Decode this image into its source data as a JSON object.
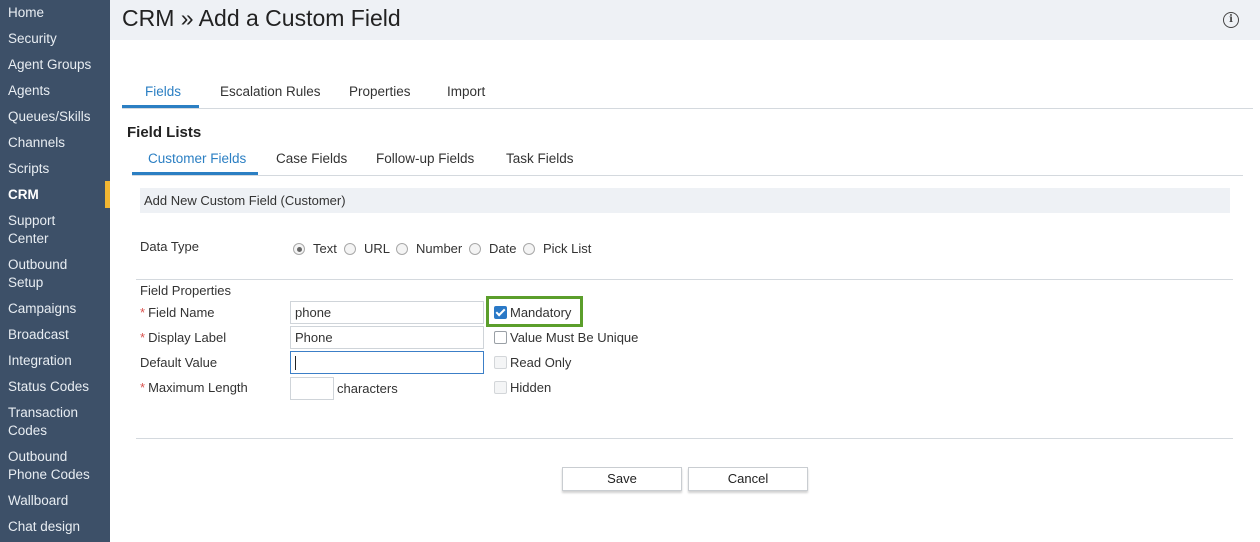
{
  "sidebar": {
    "items": [
      {
        "label": "Home"
      },
      {
        "label": "Security"
      },
      {
        "label": "Agent Groups"
      },
      {
        "label": "Agents"
      },
      {
        "label": "Queues/Skills"
      },
      {
        "label": "Channels"
      },
      {
        "label": "Scripts"
      },
      {
        "label": "CRM"
      },
      {
        "label": "Support Center"
      },
      {
        "label": "Outbound Setup"
      },
      {
        "label": "Campaigns"
      },
      {
        "label": "Broadcast"
      },
      {
        "label": "Integration"
      },
      {
        "label": "Status Codes"
      },
      {
        "label": "Transaction Codes"
      },
      {
        "label": "Outbound Phone Codes"
      },
      {
        "label": "Wallboard"
      },
      {
        "label": "Chat design"
      }
    ],
    "active": "CRM",
    "active_marker_color": "#f2b632"
  },
  "header": {
    "title": "CRM » Add a Custom Field",
    "info_icon": "info-icon"
  },
  "main_tabs": [
    {
      "label": "Fields",
      "active": true
    },
    {
      "label": "Escalation Rules"
    },
    {
      "label": "Properties"
    },
    {
      "label": "Import"
    }
  ],
  "field_lists": {
    "heading": "Field Lists",
    "tabs": [
      {
        "label": "Customer Fields",
        "active": true
      },
      {
        "label": "Case Fields"
      },
      {
        "label": "Follow-up Fields"
      },
      {
        "label": "Task Fields"
      }
    ]
  },
  "form": {
    "panel_title": "Add New Custom Field (Customer)",
    "data_type": {
      "label": "Data Type",
      "options": [
        "Text",
        "URL",
        "Number",
        "Date",
        "Pick List"
      ],
      "selected": "Text"
    },
    "field_properties_label": "Field Properties",
    "field_name": {
      "label": "Field Name",
      "value": "phone",
      "required": "*"
    },
    "display_label": {
      "label": "Display Label",
      "value": "Phone",
      "required": "*"
    },
    "default_value": {
      "label": "Default Value",
      "value": ""
    },
    "maximum_length": {
      "label": "Maximum Length",
      "value": "",
      "unit": "characters",
      "required": "*"
    },
    "checkboxes": [
      {
        "label": "Mandatory",
        "checked": true,
        "disabled": false
      },
      {
        "label": "Value Must Be Unique",
        "checked": false,
        "disabled": false
      },
      {
        "label": "Read Only",
        "checked": false,
        "disabled": true
      },
      {
        "label": "Hidden",
        "checked": false,
        "disabled": true
      }
    ],
    "highlight_color": "#5b9e2b"
  },
  "buttons": {
    "save": "Save",
    "cancel": "Cancel"
  },
  "colors": {
    "sidebar_bg": "#3d5068",
    "accent": "#2b7fc3",
    "required": "#d9534f"
  }
}
